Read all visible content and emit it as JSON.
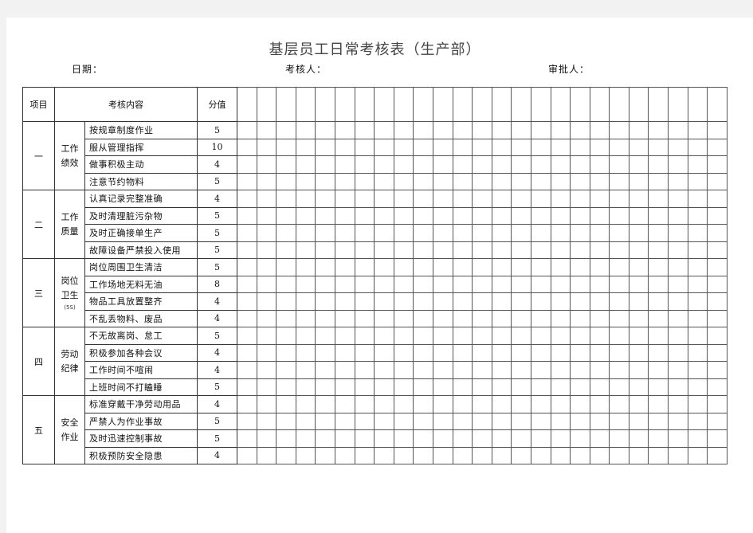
{
  "document": {
    "title": "基层员工日常考核表（生产部）",
    "date_label": "日期：",
    "examiner_label": "考核人：",
    "approver_label": "审批人："
  },
  "table": {
    "headers": {
      "item": "项目",
      "content": "考核内容",
      "score": "分值"
    },
    "blank_columns": 25,
    "sections": [
      {
        "number": "一",
        "category": "工作绩效",
        "note": "",
        "rows": [
          {
            "content": "按规章制度作业",
            "score": "5"
          },
          {
            "content": "服从管理指挥",
            "score": "10"
          },
          {
            "content": "做事积极主动",
            "score": "4"
          },
          {
            "content": "注意节约物料",
            "score": "5"
          }
        ]
      },
      {
        "number": "二",
        "category": "工作质量",
        "note": "",
        "rows": [
          {
            "content": "认真记录完整准确",
            "score": "4"
          },
          {
            "content": "及时清理脏污杂物",
            "score": "5"
          },
          {
            "content": "及时正确接单生产",
            "score": "5"
          },
          {
            "content": "故障设备严禁投入使用",
            "score": "5"
          }
        ]
      },
      {
        "number": "三",
        "category": "岗位卫生",
        "note": "(5S)",
        "rows": [
          {
            "content": "岗位周围卫生清洁",
            "score": "5"
          },
          {
            "content": "工作场地无料无油",
            "score": "8"
          },
          {
            "content": "物品工具放置整齐",
            "score": "4"
          },
          {
            "content": "不乱丢物料、废品",
            "score": "4"
          }
        ]
      },
      {
        "number": "四",
        "category": "劳动纪律",
        "note": "",
        "rows": [
          {
            "content": "不无故离岗、怠工",
            "score": "5"
          },
          {
            "content": "积极参加各种会议",
            "score": "4"
          },
          {
            "content": "工作时间不喧闹",
            "score": "4"
          },
          {
            "content": "上班时间不打瞌睡",
            "score": "5"
          }
        ]
      },
      {
        "number": "五",
        "category": "安全作业",
        "note": "",
        "rows": [
          {
            "content": "标准穿戴干净劳动用品",
            "score": "4"
          },
          {
            "content": "严禁人为作业事故",
            "score": "5"
          },
          {
            "content": "及时迅速控制事故",
            "score": "5"
          },
          {
            "content": "积极预防安全隐患",
            "score": "4"
          }
        ]
      }
    ]
  }
}
